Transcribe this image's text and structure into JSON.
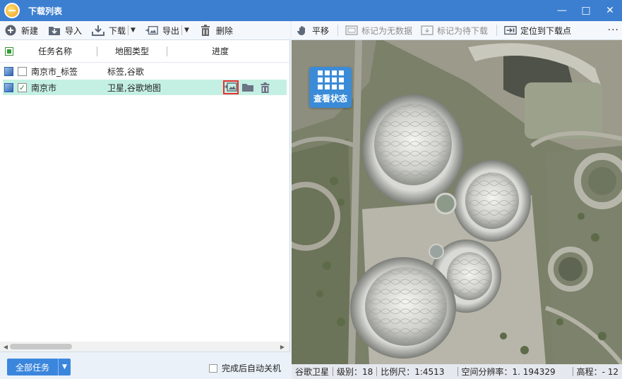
{
  "window": {
    "title": "下载列表",
    "minimize": "—",
    "maximize": "□",
    "close": "✕"
  },
  "left_toolbar": {
    "new": "新建",
    "import": "导入",
    "download": "下载",
    "export": "导出",
    "delete": "删除",
    "dropdown_glyph": "▼"
  },
  "list": {
    "columns": {
      "name": "任务名称",
      "type": "地图类型",
      "progress": "进度"
    },
    "rows": [
      {
        "name": "南京市_标签",
        "type": "标签,谷歌",
        "checked": false,
        "check_glyph": ""
      },
      {
        "name": "南京市",
        "type": "卫星,谷歌地图",
        "checked": true,
        "check_glyph": "✓"
      }
    ]
  },
  "bottom": {
    "all_tasks": "全部任务",
    "dropdown_glyph": "▼",
    "auto_shutdown": "完成后自动关机"
  },
  "right_toolbar": {
    "pan": "平移",
    "mark_no_data": "标记为无数据",
    "mark_pending": "标记为待下载",
    "locate": "定位到下载点",
    "more": "···"
  },
  "map": {
    "status_button": "查看状态",
    "status_bar": {
      "source": "谷歌卫星",
      "level": "级别：18",
      "scale": "比例尺：1:4513",
      "resolution": "空间分辨率：1. 194329",
      "elevation": "高程：- 12"
    }
  },
  "colors": {
    "titlebar": "#3c7fd1",
    "selected_row": "#c4f0e3",
    "accent_button": "#3b86dd",
    "highlight_border": "#e53030"
  }
}
